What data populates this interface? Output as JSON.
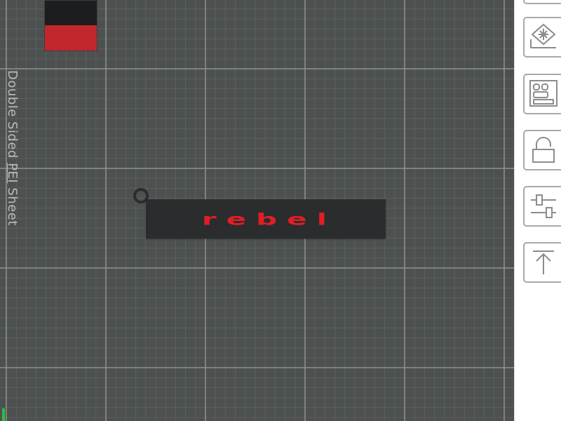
{
  "plate": {
    "label_part1": "Double Sided ",
    "label_part2": "PEI",
    "label_part3": " Sheet",
    "background_color": "#4c5150"
  },
  "filament": {
    "top_color": "#1c1d1e",
    "bottom_color": "#c1272d"
  },
  "model": {
    "text": "rebel",
    "text_color": "#e01e26",
    "body_color": "#2b2c2d"
  },
  "toolbar": {
    "buttons": [
      {
        "icon": "partial-button-icon"
      },
      {
        "icon": "auto-orient-icon"
      },
      {
        "icon": "arrange-icon"
      },
      {
        "icon": "lock-icon"
      },
      {
        "icon": "settings-sliders-icon"
      },
      {
        "icon": "lay-on-face-icon"
      }
    ]
  }
}
